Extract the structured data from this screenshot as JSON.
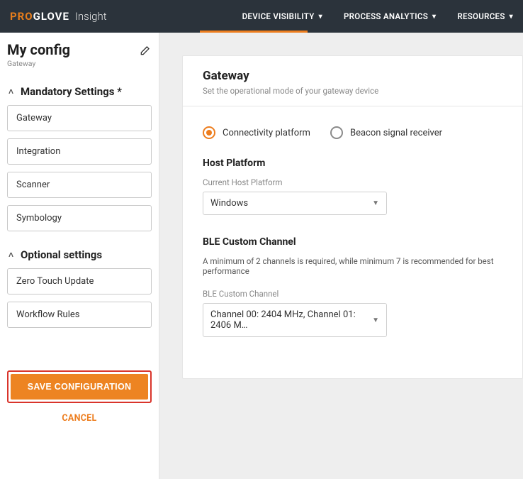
{
  "brand": {
    "part1": "PRO",
    "part2": "GLOVE",
    "sub": "Insight"
  },
  "nav": {
    "device_visibility": "DEVICE VISIBILITY",
    "process_analytics": "PROCESS ANALYTICS",
    "resources": "RESOURCES"
  },
  "sidebar": {
    "title": "My config",
    "subtitle": "Gateway",
    "section_mandatory": "Mandatory Settings *",
    "section_optional": "Optional settings",
    "mandatory_items": [
      "Gateway",
      "Integration",
      "Scanner",
      "Symbology"
    ],
    "optional_items": [
      "Zero Touch Update",
      "Workflow Rules"
    ],
    "save": "SAVE CONFIGURATION",
    "cancel": "CANCEL"
  },
  "main": {
    "title": "Gateway",
    "subtitle": "Set the operational mode of your gateway device",
    "radio_connectivity": "Connectivity platform",
    "radio_beacon": "Beacon signal receiver",
    "host_platform": {
      "heading": "Host Platform",
      "label": "Current Host Platform",
      "value": "Windows"
    },
    "ble": {
      "heading": "BLE Custom Channel",
      "note": "A minimum of 2 channels is required, while minimum 7 is recommended for best performance",
      "label": "BLE Custom Channel",
      "value": "Channel 00: 2404 MHz, Channel 01: 2406 M…"
    }
  }
}
